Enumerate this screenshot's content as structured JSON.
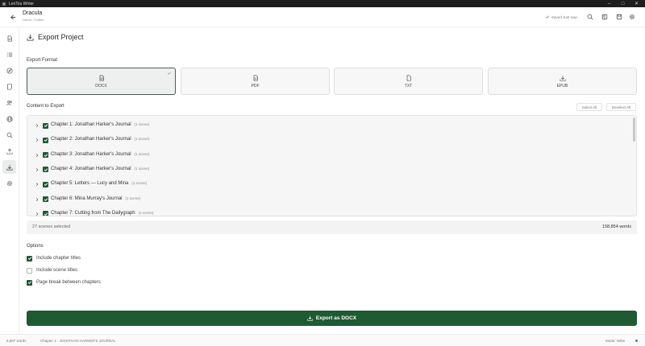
{
  "window": {
    "title": "LeoTou Writer",
    "min_glyph": "–",
    "max_glyph": "□",
    "close_glyph": "✕"
  },
  "header": {
    "project_title": "Dracula",
    "project_subtitle": "Horror / Gothic",
    "saved_status": "Saved Just now"
  },
  "page": {
    "title": "Export Project"
  },
  "export_format": {
    "label": "Export Format",
    "options": [
      "DOCX",
      "PDF",
      "TXT",
      "EPUB"
    ],
    "selected": "DOCX"
  },
  "content": {
    "label": "Content to Export",
    "select_all": "Select All",
    "deselect_all": "Deselect All",
    "chapters": [
      {
        "title": "Chapter 1: Jonathan Harker's Journal",
        "scenes": "(1 scene)"
      },
      {
        "title": "Chapter 2: Jonathan Harker's Journal",
        "scenes": "(1 scene)"
      },
      {
        "title": "Chapter 3: Jonathan Harker's Journal",
        "scenes": "(1 scene)"
      },
      {
        "title": "Chapter 4: Jonathan Harker's Journal",
        "scenes": "(1 scene)"
      },
      {
        "title": "Chapter 5: Letters — Lucy and Mina",
        "scenes": "(1 scene)"
      },
      {
        "title": "Chapter 6: Mina Murray's Journal",
        "scenes": "(1 scene)"
      },
      {
        "title": "Chapter 7: Cutting from The Dailygraph",
        "scenes": "(1 scene)"
      }
    ],
    "scenes_selected": "27 scenes selected",
    "word_total": "158,854 words"
  },
  "options": {
    "label": "Options",
    "items": [
      {
        "label": "Include chapter titles",
        "checked": true
      },
      {
        "label": "Include scene titles",
        "checked": false
      },
      {
        "label": "Page break between chapters",
        "checked": true
      }
    ]
  },
  "export_button": {
    "label": "Export as DOCX"
  },
  "statusbar": {
    "words": "5,687 words",
    "chapter": "Chapter 1 - JONATHAN HARKER'S JOURNAL",
    "mode": "Mode: Write"
  },
  "colors": {
    "accent": "#1e5a32",
    "status_dot": "#2e9a55"
  }
}
